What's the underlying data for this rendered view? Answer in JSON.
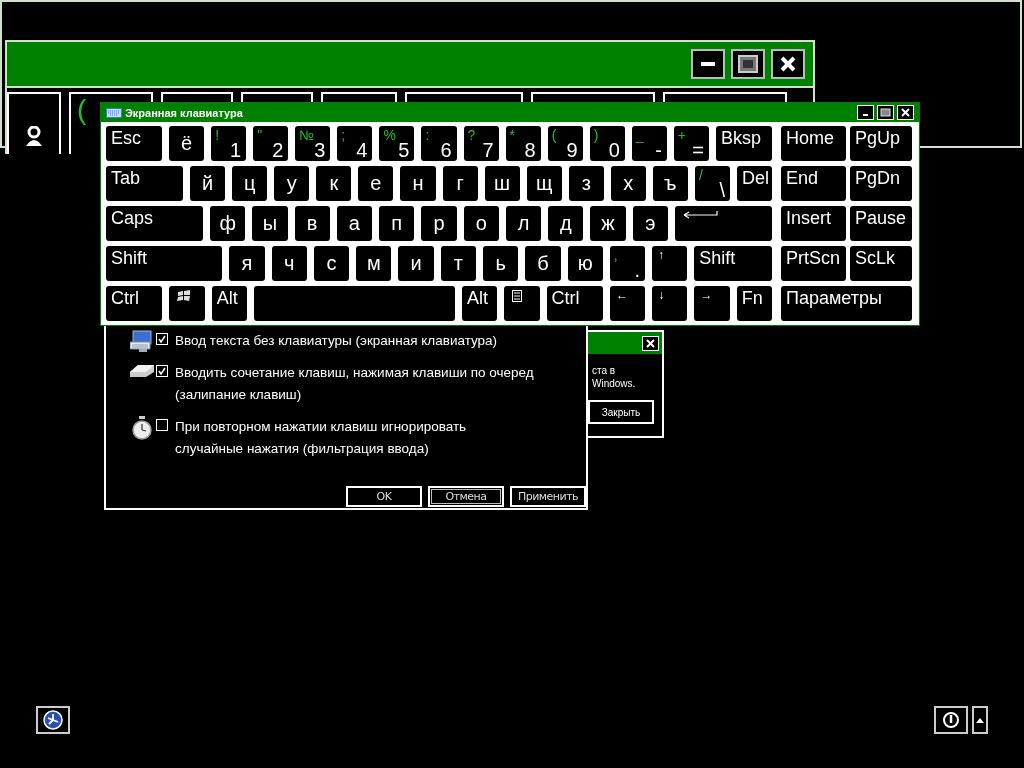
{
  "background_window": {
    "tiles": [
      {
        "kind": "user"
      },
      {
        "kind": "char",
        "text": "("
      },
      {
        "kind": "empty"
      },
      {
        "kind": "empty"
      },
      {
        "kind": "empty"
      },
      {
        "kind": "empty"
      },
      {
        "kind": "empty"
      },
      {
        "kind": "empty"
      }
    ]
  },
  "popup": {
    "lines": [
      "ста в",
      "Windows."
    ],
    "button": "Закрыть"
  },
  "dialog": {
    "options": [
      {
        "kind": "keyboard",
        "checked": true,
        "text": "Ввод текста без клавиатуры (экранная клавиатура)"
      },
      {
        "kind": "key",
        "checked": true,
        "text": "Вводить сочетание клавиш, нажимая клавиши по очеред\n(залипание клавиш)"
      },
      {
        "kind": "stopwatch",
        "checked": false,
        "text": "При повторном нажатии клавиш игнорировать\nслучайные нажатия (фильтрация ввода)"
      }
    ],
    "buttons": [
      {
        "label": "OK",
        "focused": false
      },
      {
        "label": "Отмена",
        "focused": true
      },
      {
        "label": "Применить",
        "focused": false
      }
    ]
  },
  "keyboard": {
    "title": "Экранная клавиатура",
    "rows": [
      {
        "main": [
          {
            "kind": "name",
            "label": "Esc"
          },
          {
            "kind": "letter",
            "label": "ё"
          },
          {
            "kind": "dual",
            "shift": "!",
            "label": "1"
          },
          {
            "kind": "dual",
            "shift": "\"",
            "label": "2"
          },
          {
            "kind": "dual",
            "shift": "№",
            "label": "3"
          },
          {
            "kind": "dual",
            "shift": ";",
            "label": "4"
          },
          {
            "kind": "dual",
            "shift": "%",
            "label": "5"
          },
          {
            "kind": "dual",
            "shift": ":",
            "label": "6"
          },
          {
            "kind": "dual",
            "shift": "?",
            "label": "7"
          },
          {
            "kind": "dual",
            "shift": "*",
            "label": "8"
          },
          {
            "kind": "dual",
            "shift": "(",
            "label": "9"
          },
          {
            "kind": "dual",
            "shift": ")",
            "label": "0"
          },
          {
            "kind": "dual",
            "shift": "_",
            "label": "-"
          },
          {
            "kind": "dual",
            "shift": "+",
            "label": "="
          },
          {
            "kind": "name",
            "label": "Bksp"
          }
        ],
        "nav": [
          {
            "kind": "name",
            "label": "Home"
          },
          {
            "kind": "name",
            "label": "PgUp"
          }
        ]
      },
      {
        "main": [
          {
            "kind": "name",
            "label": "Tab"
          },
          {
            "kind": "letter",
            "label": "й"
          },
          {
            "kind": "letter",
            "label": "ц"
          },
          {
            "kind": "letter",
            "label": "у"
          },
          {
            "kind": "letter",
            "label": "к"
          },
          {
            "kind": "letter",
            "label": "е"
          },
          {
            "kind": "letter",
            "label": "н"
          },
          {
            "kind": "letter",
            "label": "г"
          },
          {
            "kind": "letter",
            "label": "ш"
          },
          {
            "kind": "letter",
            "label": "щ"
          },
          {
            "kind": "letter",
            "label": "з"
          },
          {
            "kind": "letter",
            "label": "х"
          },
          {
            "kind": "letter",
            "label": "ъ"
          },
          {
            "kind": "dual",
            "shift": "/",
            "label": "\\"
          },
          {
            "kind": "name",
            "label": "Del"
          }
        ],
        "nav": [
          {
            "kind": "name",
            "label": "End"
          },
          {
            "kind": "name",
            "label": "PgDn"
          }
        ]
      },
      {
        "main": [
          {
            "kind": "name",
            "label": "Caps"
          },
          {
            "kind": "letter",
            "label": "ф"
          },
          {
            "kind": "letter",
            "label": "ы"
          },
          {
            "kind": "letter",
            "label": "в"
          },
          {
            "kind": "letter",
            "label": "а"
          },
          {
            "kind": "letter",
            "label": "п"
          },
          {
            "kind": "letter",
            "label": "р"
          },
          {
            "kind": "letter",
            "label": "о"
          },
          {
            "kind": "letter",
            "label": "л"
          },
          {
            "kind": "letter",
            "label": "д"
          },
          {
            "kind": "letter",
            "label": "ж"
          },
          {
            "kind": "letter",
            "label": "э"
          },
          {
            "kind": "enter"
          }
        ],
        "nav": [
          {
            "kind": "name",
            "label": "Insert"
          },
          {
            "kind": "name",
            "label": "Pause"
          }
        ]
      },
      {
        "main": [
          {
            "kind": "name",
            "label": "Shift"
          },
          {
            "kind": "letter",
            "label": "я"
          },
          {
            "kind": "letter",
            "label": "ч"
          },
          {
            "kind": "letter",
            "label": "с"
          },
          {
            "kind": "letter",
            "label": "м"
          },
          {
            "kind": "letter",
            "label": "и"
          },
          {
            "kind": "letter",
            "label": "т"
          },
          {
            "kind": "letter",
            "label": "ь"
          },
          {
            "kind": "letter",
            "label": "б"
          },
          {
            "kind": "letter",
            "label": "ю"
          },
          {
            "kind": "dual",
            "shift": ",",
            "label": "."
          },
          {
            "kind": "arrow",
            "label": "↑"
          },
          {
            "kind": "name",
            "label": "Shift"
          }
        ],
        "nav": [
          {
            "kind": "name",
            "label": "PrtScn"
          },
          {
            "kind": "name",
            "label": "ScLk"
          }
        ]
      },
      {
        "main": [
          {
            "kind": "name",
            "label": "Ctrl"
          },
          {
            "kind": "windows"
          },
          {
            "kind": "name",
            "label": "Alt"
          },
          {
            "kind": "space"
          },
          {
            "kind": "name",
            "label": "Alt"
          },
          {
            "kind": "menu"
          },
          {
            "kind": "name",
            "label": "Ctrl"
          },
          {
            "kind": "arrow",
            "label": "←"
          },
          {
            "kind": "arrow",
            "label": "↓"
          },
          {
            "kind": "arrow",
            "label": "→"
          },
          {
            "kind": "name",
            "label": "Fn"
          }
        ],
        "nav": [
          {
            "kind": "name",
            "label": "Параметры"
          }
        ]
      }
    ]
  }
}
